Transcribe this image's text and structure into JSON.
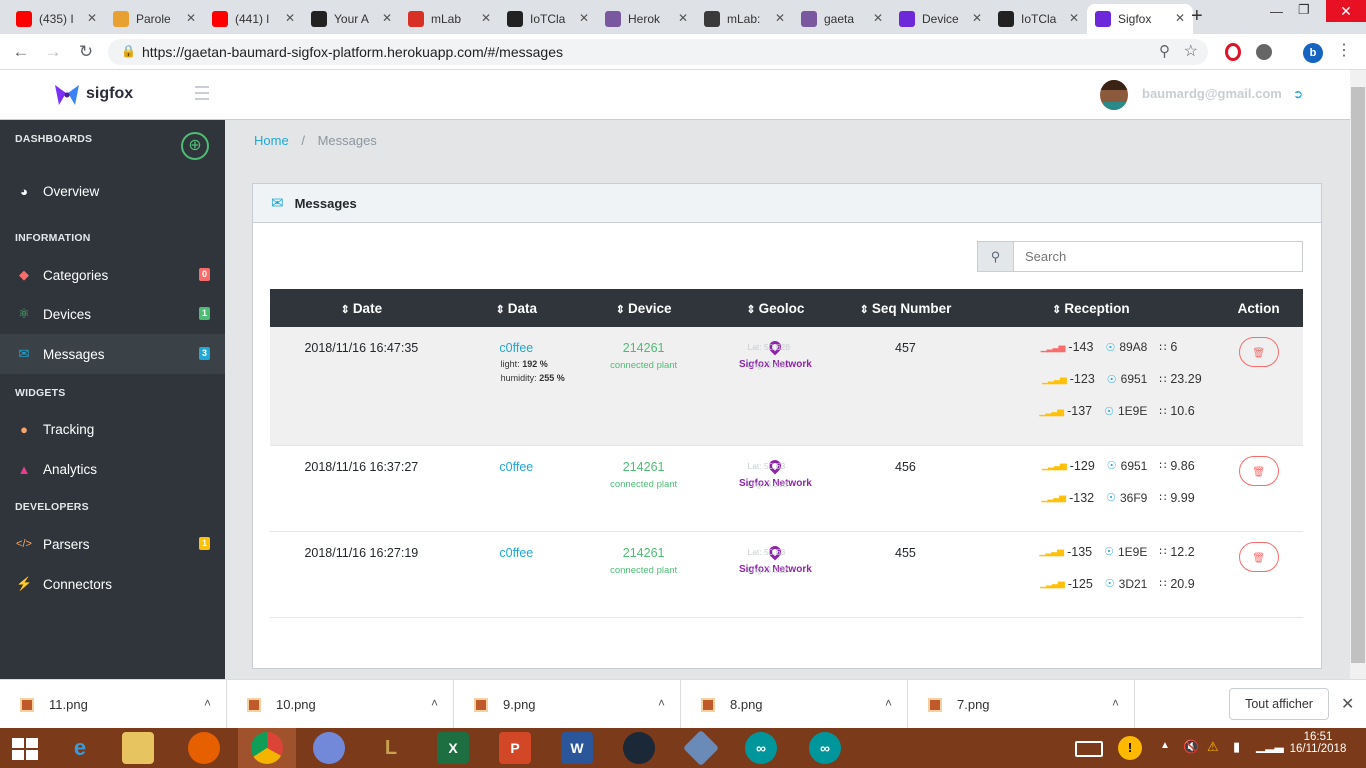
{
  "browser": {
    "tabs": [
      {
        "label": "(435) I",
        "icon": "youtube-icon",
        "color": "#ff0000"
      },
      {
        "label": "Parole",
        "icon": "sun-icon",
        "color": "#e8a030"
      },
      {
        "label": "(441) l",
        "icon": "youtube-icon",
        "color": "#ff0000"
      },
      {
        "label": "Your A",
        "icon": "github-icon",
        "color": "#222222"
      },
      {
        "label": "mLab",
        "icon": "gmail-icon",
        "color": "#d93025"
      },
      {
        "label": "IoTCla",
        "icon": "github-icon",
        "color": "#222222"
      },
      {
        "label": "Herok",
        "icon": "heroku-icon",
        "color": "#79589f"
      },
      {
        "label": "mLab:",
        "icon": "mlab-icon",
        "color": "#3a3a3a"
      },
      {
        "label": "gaeta",
        "icon": "heroku-icon",
        "color": "#79589f"
      },
      {
        "label": "Device",
        "icon": "sigfox-icon",
        "color": "#6d28d9"
      },
      {
        "label": "IoTCla",
        "icon": "github-icon",
        "color": "#222222"
      },
      {
        "label": "Sigfox",
        "icon": "sigfox-icon",
        "color": "#6d28d9",
        "active": true
      }
    ],
    "url": "https://gaetan-baumard-sigfox-platform.herokuapp.com/#/messages",
    "profile_letter": "b"
  },
  "app": {
    "brand": "sigfox",
    "user_email": "baumardg@gmail.com"
  },
  "sidebar": {
    "sections": {
      "dashboards": "DASHBOARDS",
      "information": "INFORMATION",
      "widgets": "WIDGETS",
      "developers": "DEVELOPERS"
    },
    "items": {
      "overview": {
        "label": "Overview"
      },
      "categories": {
        "label": "Categories",
        "badge": "0",
        "badge_color": "#f86c6b"
      },
      "devices": {
        "label": "Devices",
        "badge": "1",
        "badge_color": "#4dbd74"
      },
      "messages": {
        "label": "Messages",
        "badge": "3",
        "badge_color": "#20a8d8"
      },
      "tracking": {
        "label": "Tracking"
      },
      "analytics": {
        "label": "Analytics"
      },
      "parsers": {
        "label": "Parsers",
        "badge": "1",
        "badge_color": "#ffc107"
      },
      "connectors": {
        "label": "Connectors"
      }
    }
  },
  "breadcrumb": {
    "home": "Home",
    "sep": "/",
    "current": "Messages"
  },
  "card": {
    "title": "Messages",
    "search_placeholder": "Search",
    "columns": [
      "Date",
      "Data",
      "Device",
      "Geoloc",
      "Seq Number",
      "Reception",
      "Action"
    ],
    "rows": [
      {
        "date": "2018/11/16 16:47:35",
        "data": "c0ffee",
        "extra": [
          {
            "key": "light:",
            "val": "192 %"
          },
          {
            "key": "humidity:",
            "val": "255 %"
          }
        ],
        "device": "214261",
        "device_sub": "connected plant",
        "geo_source": "Sigfox Network",
        "lat": "Lat: 50.628",
        "lng": "Lng: 3.051",
        "seq": "457",
        "reception": [
          {
            "rssi": "-143",
            "station": "89A8",
            "snr": "6",
            "strength": "low"
          },
          {
            "rssi": "-123",
            "station": "6951",
            "snr": "23.29",
            "strength": "good"
          },
          {
            "rssi": "-137",
            "station": "1E9E",
            "snr": "10.6",
            "strength": "good"
          }
        ]
      },
      {
        "date": "2018/11/16 16:37:27",
        "data": "c0ffee",
        "extra": [],
        "device": "214261",
        "device_sub": "connected plant",
        "geo_source": "Sigfox Network",
        "lat": "Lat: 50.63",
        "lng": "Lng: 3.053",
        "seq": "456",
        "reception": [
          {
            "rssi": "-129",
            "station": "6951",
            "snr": "9.86",
            "strength": "good"
          },
          {
            "rssi": "-132",
            "station": "36F9",
            "snr": "9.99",
            "strength": "good"
          }
        ]
      },
      {
        "date": "2018/11/16 16:27:19",
        "data": "c0ffee",
        "extra": [],
        "device": "214261",
        "device_sub": "connected plant",
        "geo_source": "Sigfox Network",
        "lat": "Lat: 50.63",
        "lng": "Lng: 3.052",
        "seq": "455",
        "reception": [
          {
            "rssi": "-135",
            "station": "1E9E",
            "snr": "12.2",
            "strength": "good"
          },
          {
            "rssi": "-125",
            "station": "3D21",
            "snr": "20.9",
            "strength": "good"
          }
        ]
      }
    ]
  },
  "downloads": {
    "files": [
      "11.png",
      "10.png",
      "9.png",
      "8.png",
      "7.png"
    ],
    "show_all": "Tout afficher"
  },
  "taskbar": {
    "time": "16:51",
    "date": "16/11/2018"
  }
}
